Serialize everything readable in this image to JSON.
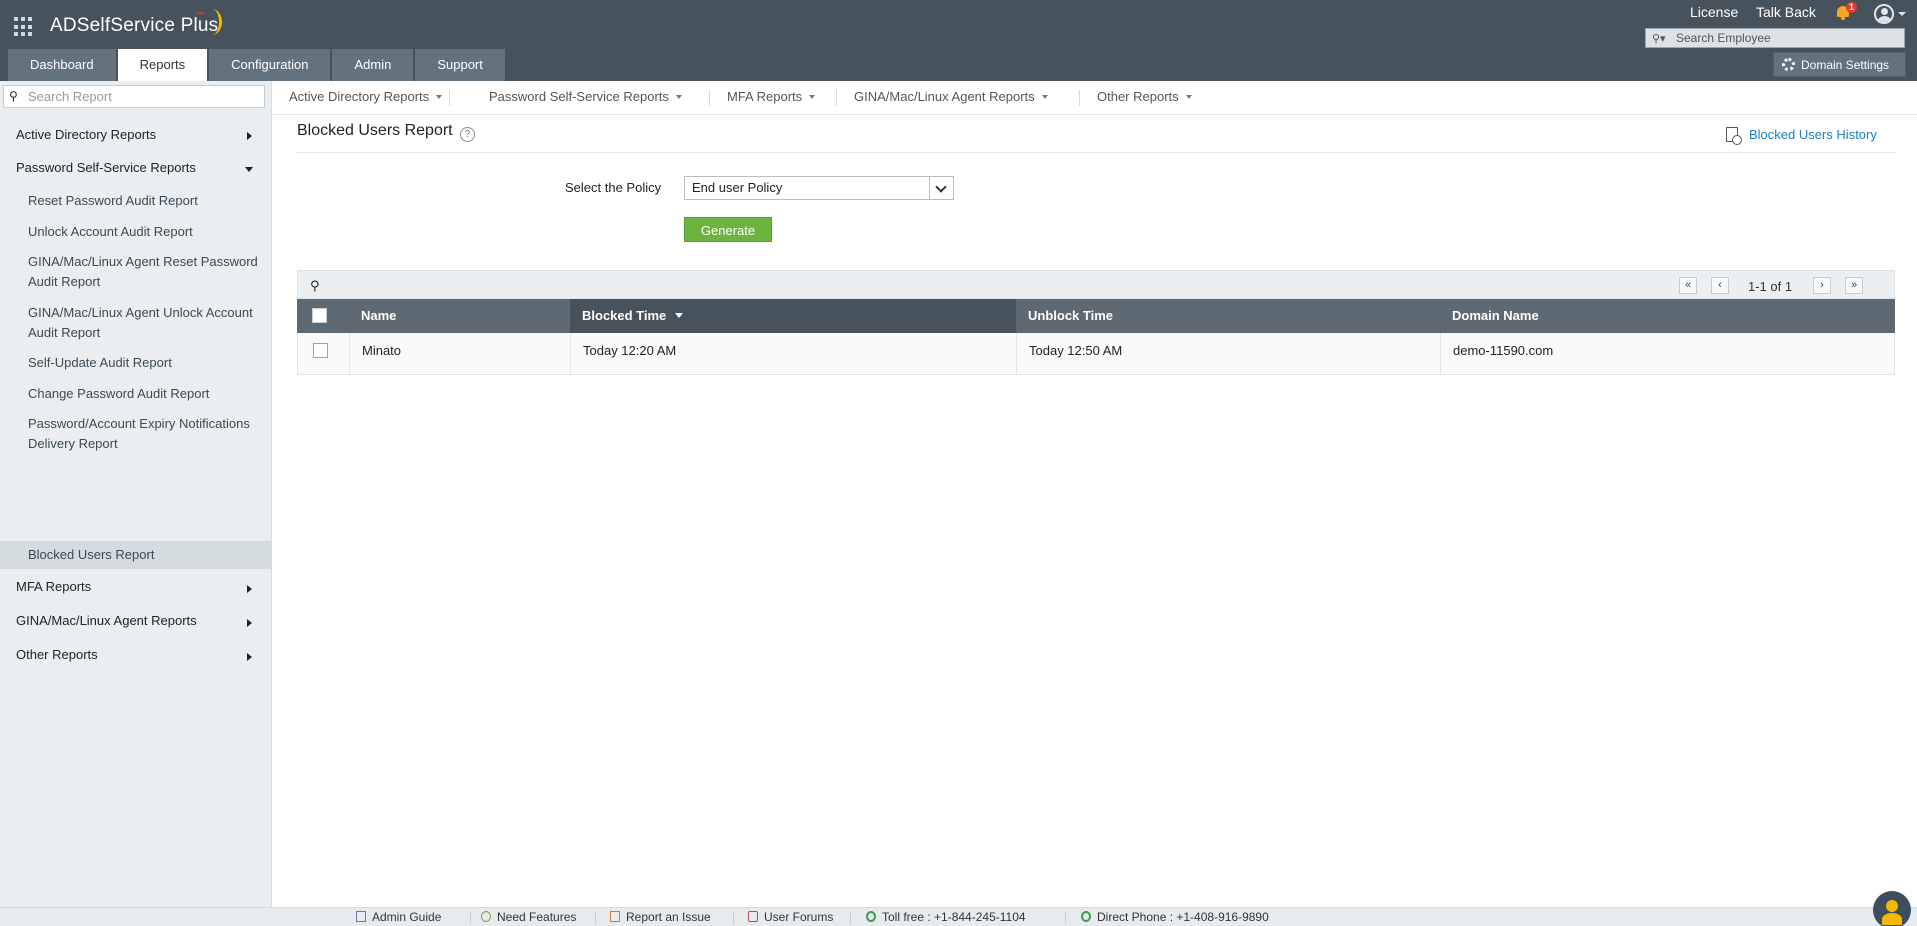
{
  "header": {
    "brand_part1": "ADSelfService",
    "brand_part2": " Plus",
    "license": "License",
    "talk_back": "Talk Back",
    "notification_count": "1",
    "employee_search_placeholder": "Search Employee",
    "domain_settings": "Domain Settings",
    "tabs": [
      {
        "label": "Dashboard",
        "active": false
      },
      {
        "label": "Reports",
        "active": true
      },
      {
        "label": "Configuration",
        "active": false
      },
      {
        "label": "Admin",
        "active": false
      },
      {
        "label": "Support",
        "active": false
      }
    ]
  },
  "sidebar": {
    "search_placeholder": "Search Report",
    "categories": {
      "active_directory": "Active Directory Reports",
      "password_self_service": "Password Self-Service Reports",
      "mfa": "MFA Reports",
      "gina_agent": "GINA/Mac/Linux Agent Reports",
      "other": "Other Reports"
    },
    "sub_items": [
      "Reset Password Audit Report",
      "Unlock Account Audit Report",
      "GINA/Mac/Linux Agent Reset Password Audit Report",
      "GINA/Mac/Linux Agent Unlock Account Audit Report",
      "Self-Update Audit Report",
      "Change Password Audit Report",
      "Password/Account Expiry Notifications Delivery Report",
      "Blocked Users Report"
    ],
    "active_item": "Blocked Users Report"
  },
  "subnav": [
    "Active Directory Reports",
    "Password Self-Service Reports",
    "MFA Reports",
    "GINA/Mac/Linux Agent Reports",
    "Other Reports"
  ],
  "main": {
    "title": "Blocked Users Report",
    "help": "?",
    "history_link": "Blocked Users History",
    "policy_label": "Select the Policy",
    "policy_value": "End user Policy",
    "generate_label": "Generate"
  },
  "table": {
    "pagination": "1-1 of 1",
    "columns": [
      "Name",
      "Blocked Time",
      "Unblock Time",
      "Domain Name"
    ],
    "sorted_column": "Blocked Time",
    "rows": [
      {
        "name": "Minato",
        "blocked_time": "Today 12:20 AM",
        "unblock_time": "Today 12:50 AM",
        "domain": "demo-11590.com"
      }
    ]
  },
  "footer": {
    "admin_guide": "Admin Guide",
    "need_features": "Need Features",
    "report_issue": "Report an Issue",
    "user_forums": "User Forums",
    "toll_free": "Toll free : +1-844-245-1104",
    "direct_phone": "Direct Phone : +1-408-916-9890"
  },
  "colors": {
    "header_bg": "#46525c",
    "tab_bg": "#63727d",
    "accent_link": "#1a7fc4",
    "generate_green": "#6cb33f",
    "notification_red": "#e23b2e"
  }
}
